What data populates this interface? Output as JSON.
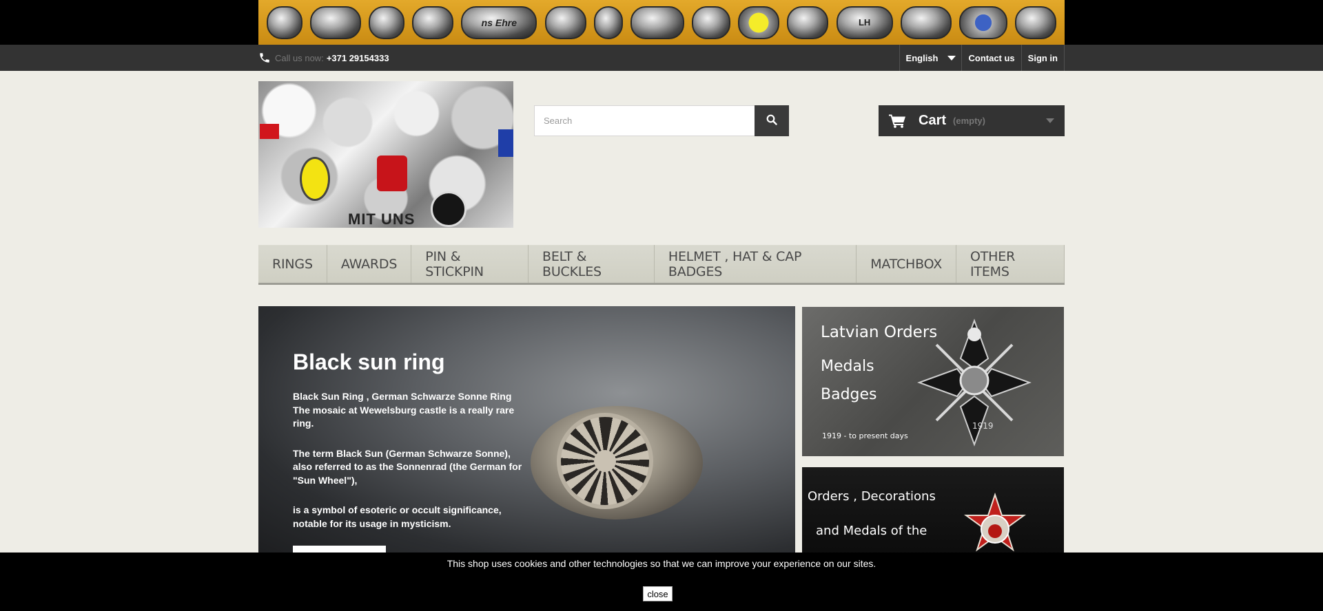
{
  "topbar": {
    "call_label": "Call us now:",
    "phone": "+371 29154333",
    "language": "English",
    "contact": "Contact us",
    "signin": "Sign in"
  },
  "banner": {
    "ring_engravings": [
      "ns Ehre",
      "LH"
    ]
  },
  "logo": {
    "text": "MIT UNS"
  },
  "search": {
    "placeholder": "Search"
  },
  "cart": {
    "title": "Cart",
    "status": "(empty)"
  },
  "menu": {
    "items": [
      "Rings",
      "Awards",
      "Pin & Stickpin",
      "Belt & Buckles",
      "Helmet , Hat & Cap badges",
      "Matchbox",
      "Other items"
    ]
  },
  "slider": {
    "title": "Black sun ring",
    "paragraphs": [
      "Black Sun Ring , German Schwarze Sonne Ring The mosaic at Wewelsburg castle is a really rare ring.",
      "The term Black Sun (German Schwarze Sonne), also referred to as the Sonnenrad (the German for \"Sun Wheel\"),",
      "is a symbol of esoteric or occult significance, notable for its usage in mysticism."
    ]
  },
  "side_banners": {
    "banner1": {
      "line1": "Latvian Orders",
      "line2": "Medals",
      "line3": "Badges",
      "caption": "1919 - to present days",
      "badge_year": "1919"
    },
    "banner2": {
      "line1": "Orders , Decorations",
      "line2": "and Medals of the"
    }
  },
  "cookie": {
    "message": "This shop uses cookies and other technologies so that we can improve your experience on our sites.",
    "close_label": "close"
  },
  "colors": {
    "topbar_bg": "#333333",
    "banner_gold": "#d79a1d",
    "menu_bg": "#d9d9cf",
    "cookie_bg": "#000000"
  }
}
